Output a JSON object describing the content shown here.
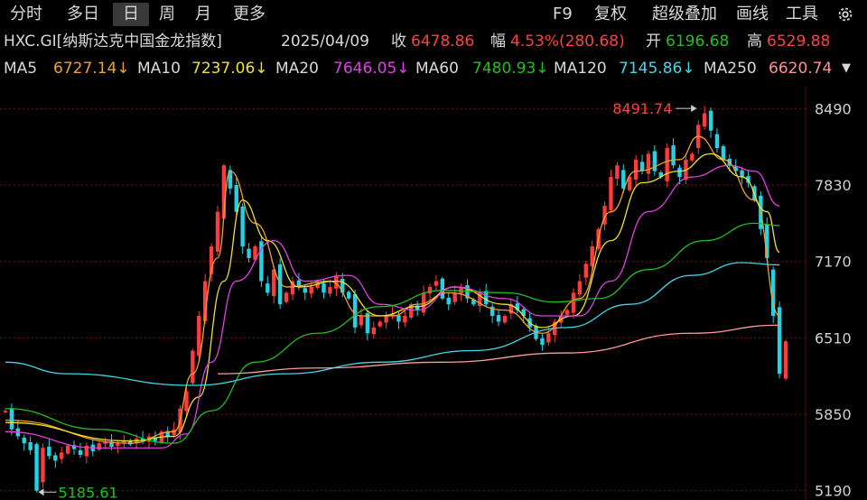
{
  "toolbar": {
    "tabs": [
      "分时",
      "多日",
      "日",
      "周",
      "月",
      "更多"
    ],
    "active_tab": "日",
    "right_tools": [
      "F9",
      "复权",
      "超级叠加",
      "画线",
      "工具"
    ]
  },
  "info": {
    "code_name": "HXC.GI[纳斯达克中国金龙指数]",
    "date": "2025/04/09",
    "close_label": "收",
    "close_value": "6478.86",
    "change_label": "幅",
    "change_value": "4.53%(280.68)",
    "open_label": "开",
    "open_value": "6196.68",
    "high_label": "高",
    "high_value": "6529.88"
  },
  "ma_line": {
    "ma5_label": "MA5",
    "ma5_value": "6727.14↓",
    "ma10_label": "MA10",
    "ma10_value": "7237.06↓",
    "ma20_label": "MA20",
    "ma20_value": "7646.05↓",
    "ma60_label": "MA60",
    "ma60_value": "7480.93↓",
    "ma120_label": "MA120",
    "ma120_value": "7145.86↓",
    "ma250_label": "MA250",
    "ma250_value": "6620.74"
  },
  "colors": {
    "up": "#ff3b3b",
    "down": "#22d3e6",
    "ma5": "#f0a030",
    "ma10": "#f0e030",
    "ma20": "#e040e0",
    "ma60": "#20c020",
    "ma120": "#40d8e8",
    "ma250": "#ff9a9a",
    "grid": "#7a1212",
    "axis_text": "#d0d0d0"
  },
  "chart_data": {
    "type": "candlestick",
    "y_ticks": [
      5190,
      5850,
      6510,
      7170,
      7830,
      8490
    ],
    "ylim": [
      5110,
      8680
    ],
    "annotations": [
      {
        "label": "8491.74",
        "value": 8491.74,
        "kind": "high"
      },
      {
        "label": "5185.61",
        "value": 5185.61,
        "kind": "low"
      }
    ],
    "close_path": [
      5880,
      5720,
      5660,
      5600,
      5540,
      5190,
      5560,
      5490,
      5450,
      5520,
      5580,
      5550,
      5500,
      5580,
      5530,
      5600,
      5610,
      5570,
      5600,
      5620,
      5590,
      5640,
      5620,
      5660,
      5620,
      5700,
      5660,
      5720,
      5900,
      6050,
      6400,
      6700,
      7000,
      7300,
      7600,
      8000,
      7800,
      7600,
      7300,
      7200,
      7300,
      7000,
      6900,
      7100,
      6800,
      6900,
      7000,
      6950,
      6900,
      6950,
      7000,
      6900,
      6950,
      7050,
      6900,
      6850,
      6600,
      6700,
      6550,
      6600,
      6650,
      6700,
      6720,
      6650,
      6700,
      6800,
      6750,
      6900,
      6950,
      7000,
      6850,
      6800,
      6900,
      6950,
      6850,
      6800,
      6900,
      6800,
      6700,
      6650,
      6700,
      6800,
      6750,
      6700,
      6600,
      6500,
      6450,
      6550,
      6650,
      6700,
      6750,
      6900,
      7000,
      7150,
      7300,
      7450,
      7650,
      7900,
      8000,
      7800,
      7900,
      8050,
      7950,
      8100,
      7950,
      7900,
      8150,
      8000,
      7900,
      8050,
      8100,
      8350,
      8450,
      8300,
      8150,
      8050,
      8000,
      7950,
      7900,
      7850,
      7700,
      7450,
      7200,
      6700,
      6200,
      6480
    ],
    "ma_series": {
      "ma5": [
        [
          0,
          5800
        ],
        [
          20,
          5600
        ],
        [
          27,
          5700
        ],
        [
          30,
          6200
        ],
        [
          34,
          7200
        ],
        [
          36,
          7950
        ],
        [
          40,
          7500
        ],
        [
          45,
          6950
        ],
        [
          52,
          7000
        ],
        [
          57,
          6700
        ],
        [
          62,
          6700
        ],
        [
          66,
          6800
        ],
        [
          71,
          6900
        ],
        [
          80,
          6750
        ],
        [
          86,
          6550
        ],
        [
          92,
          6850
        ],
        [
          97,
          7600
        ],
        [
          101,
          7950
        ],
        [
          108,
          8050
        ],
        [
          111,
          8250
        ],
        [
          115,
          8050
        ],
        [
          120,
          7700
        ],
        [
          124,
          6700
        ]
      ],
      "ma10": [
        [
          0,
          5780
        ],
        [
          20,
          5620
        ],
        [
          27,
          5660
        ],
        [
          31,
          6000
        ],
        [
          35,
          7000
        ],
        [
          38,
          7700
        ],
        [
          42,
          7350
        ],
        [
          47,
          6950
        ],
        [
          53,
          7000
        ],
        [
          60,
          6700
        ],
        [
          66,
          6780
        ],
        [
          72,
          6950
        ],
        [
          80,
          6800
        ],
        [
          86,
          6600
        ],
        [
          91,
          6700
        ],
        [
          97,
          7350
        ],
        [
          102,
          7850
        ],
        [
          108,
          7950
        ],
        [
          113,
          8100
        ],
        [
          118,
          7900
        ],
        [
          122,
          7600
        ],
        [
          124,
          7250
        ]
      ],
      "ma20": [
        [
          0,
          5700
        ],
        [
          15,
          5560
        ],
        [
          25,
          5560
        ],
        [
          29,
          5680
        ],
        [
          33,
          6300
        ],
        [
          37,
          7000
        ],
        [
          43,
          7350
        ],
        [
          48,
          7000
        ],
        [
          55,
          7050
        ],
        [
          60,
          6800
        ],
        [
          66,
          6750
        ],
        [
          72,
          6950
        ],
        [
          80,
          6850
        ],
        [
          86,
          6700
        ],
        [
          92,
          6700
        ],
        [
          97,
          7000
        ],
        [
          103,
          7600
        ],
        [
          110,
          7900
        ],
        [
          116,
          8000
        ],
        [
          120,
          7950
        ],
        [
          124,
          7650
        ]
      ],
      "ma60": [
        [
          0,
          5900
        ],
        [
          15,
          5720
        ],
        [
          27,
          5600
        ],
        [
          33,
          5880
        ],
        [
          40,
          6300
        ],
        [
          50,
          6550
        ],
        [
          60,
          6780
        ],
        [
          70,
          6920
        ],
        [
          80,
          6900
        ],
        [
          88,
          6820
        ],
        [
          95,
          6850
        ],
        [
          103,
          7100
        ],
        [
          112,
          7350
        ],
        [
          120,
          7500
        ],
        [
          124,
          7480
        ]
      ],
      "ma120": [
        [
          0,
          6300
        ],
        [
          10,
          6200
        ],
        [
          30,
          6100
        ],
        [
          45,
          6200
        ],
        [
          60,
          6300
        ],
        [
          75,
          6400
        ],
        [
          90,
          6600
        ],
        [
          100,
          6800
        ],
        [
          110,
          7050
        ],
        [
          118,
          7160
        ],
        [
          124,
          7140
        ]
      ],
      "ma250": [
        [
          34,
          6200
        ],
        [
          50,
          6250
        ],
        [
          70,
          6300
        ],
        [
          90,
          6380
        ],
        [
          110,
          6550
        ],
        [
          124,
          6620
        ]
      ]
    }
  }
}
